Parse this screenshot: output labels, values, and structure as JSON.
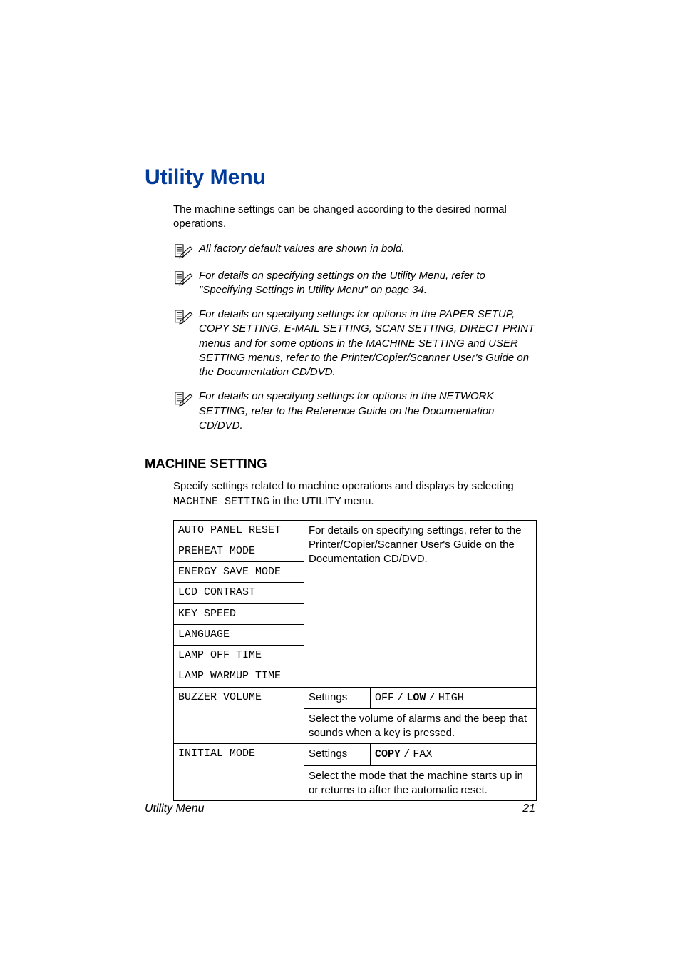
{
  "title": "Utility Menu",
  "intro": "The machine settings can be changed according to the desired normal operations.",
  "notes": [
    "All factory default values are shown in bold.",
    "For details on specifying settings on the Utility Menu, refer to \"Specifying Settings in Utility Menu\" on page 34.",
    "For details on specifying settings for options in the PAPER SETUP, COPY SETTING, E-MAIL SETTING, SCAN SETTING, DIRECT PRINT menus and for some options in the MACHINE SETTING and USER SETTING menus, refer to the Printer/Copier/Scanner User's Guide on the Documentation CD/DVD.",
    "For details on specifying settings for options in the NETWORK SETTING, refer to the Reference Guide on the Documentation CD/DVD."
  ],
  "section_title": "MACHINE SETTING",
  "section_intro_a": "Specify settings related to machine operations and displays by selecting",
  "section_intro_mono": "MACHINE SETTING",
  "section_intro_b": "in the UTILITY menu.",
  "table": {
    "simple_block": {
      "rows": [
        "AUTO PANEL RESET",
        "PREHEAT MODE",
        "ENERGY SAVE MODE",
        "LCD CONTRAST",
        "KEY SPEED",
        "LANGUAGE",
        "LAMP OFF TIME",
        "LAMP WARMUP TIME"
      ],
      "desc": "For details on specifying settings, refer to the Printer/Copier/Scanner User's Guide on the Documentation CD/DVD."
    },
    "buzzer": {
      "label": "BUZZER VOLUME",
      "settings_label": "Settings",
      "options_prefix": "OFF",
      "options_sep1": "/",
      "options_default": "LOW",
      "options_sep2": "/",
      "options_suffix": "HIGH",
      "desc": "Select the volume of alarms and the beep that sounds when a key is pressed."
    },
    "initial": {
      "label": "INITIAL MODE",
      "settings_label": "Settings",
      "options_default": "COPY",
      "options_sep": "/",
      "options_suffix": "FAX",
      "desc": "Select the mode that the machine starts up in or returns to after the automatic reset."
    }
  },
  "footer": {
    "left": "Utility Menu",
    "right": "21"
  }
}
